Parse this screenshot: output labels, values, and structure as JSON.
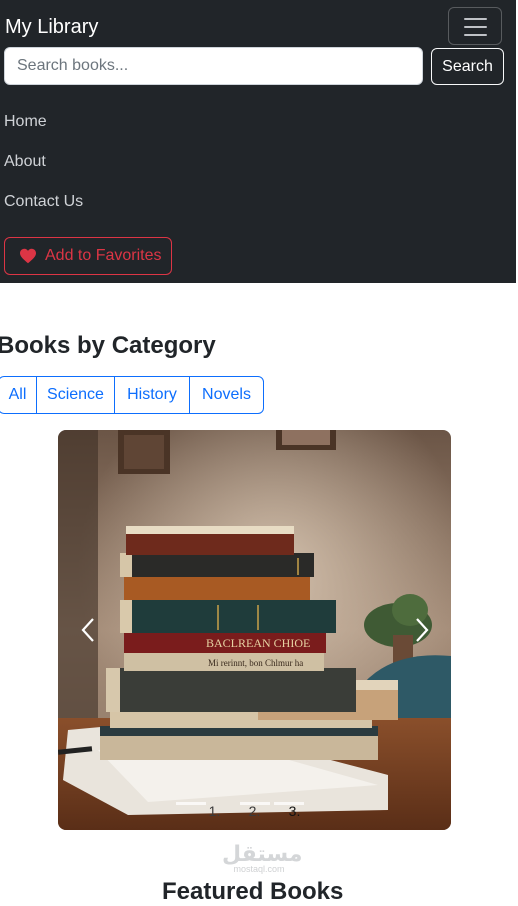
{
  "navbar": {
    "brand": "My Library",
    "search": {
      "placeholder": "Search books...",
      "value": "",
      "button_label": "Search"
    },
    "links": [
      "Home",
      "About",
      "Contact Us"
    ],
    "favorites_label": "Add to Favorites"
  },
  "categories": {
    "title": "Books by Category",
    "items": [
      "All",
      "Science",
      "History",
      "Novels"
    ]
  },
  "carousel": {
    "indicators": [
      "1.",
      "2.",
      "3."
    ],
    "active_index": 2,
    "book_spine_lines": [
      "BACLREAN CHIOE",
      "Mi rerinnt, bon Chlmur ha"
    ]
  },
  "watermark": {
    "text": "مستقل",
    "sub": "mostaql.com"
  },
  "featured": {
    "title": "Featured Books"
  },
  "colors": {
    "navbar_bg": "#212529",
    "primary": "#0d6efd",
    "danger": "#dc3545"
  },
  "icons": {
    "menu": "hamburger-icon",
    "favorite": "heart-icon",
    "prev": "chevron-left-icon",
    "next": "chevron-right-icon"
  }
}
